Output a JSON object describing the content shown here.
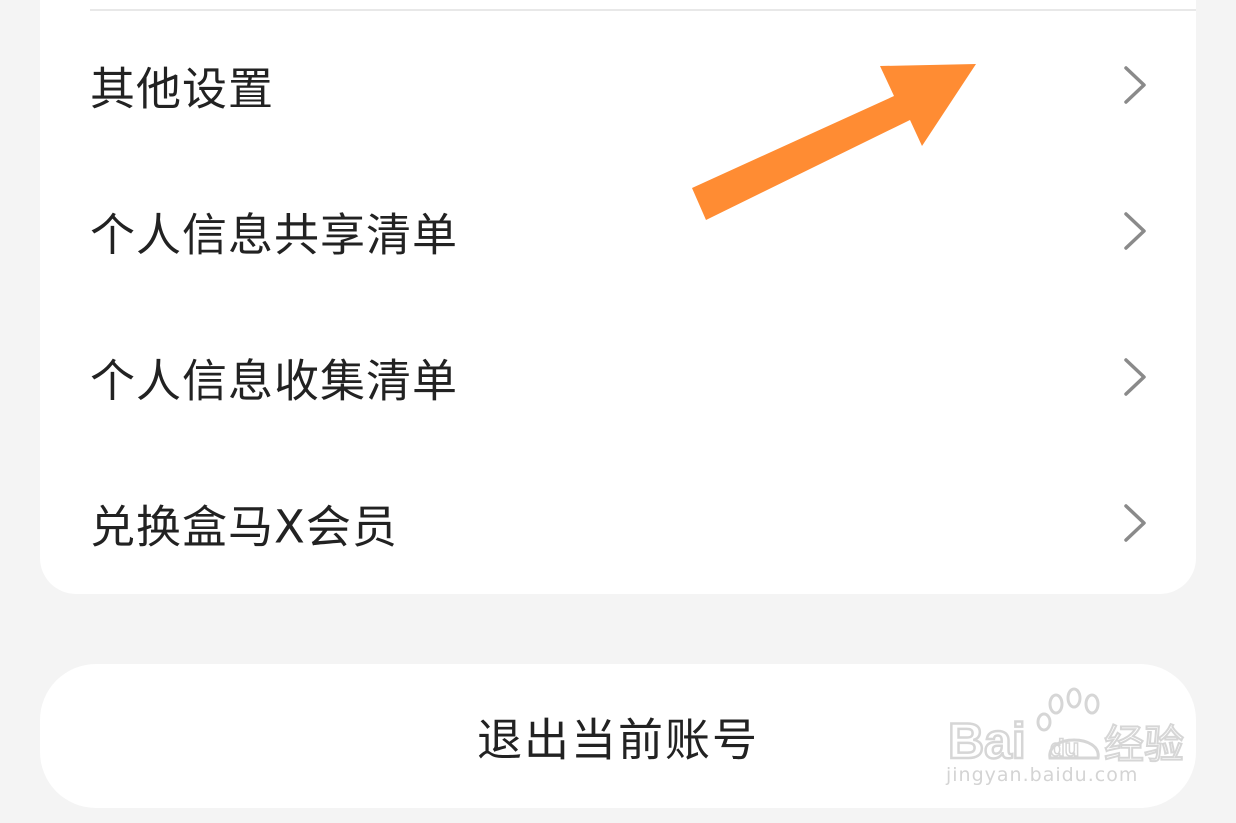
{
  "menu": {
    "items": [
      {
        "label": "其他设置",
        "icon": "chevron-right-icon"
      },
      {
        "label": "个人信息共享清单",
        "icon": "chevron-right-icon"
      },
      {
        "label": "个人信息收集清单",
        "icon": "chevron-right-icon"
      },
      {
        "label": "兑换盒马X会员",
        "icon": "chevron-right-icon"
      }
    ]
  },
  "logout": {
    "label": "退出当前账号"
  },
  "annotation": {
    "icon": "arrow-pointer-icon",
    "color": "#ff8c33"
  },
  "watermark": {
    "logo": "Baidu 经验",
    "site": "jingyan.baidu.com"
  },
  "colors": {
    "background": "#f4f4f4",
    "card": "#ffffff",
    "text": "#222222",
    "chevron": "#8a8a8a",
    "divider": "#e8e8e8"
  }
}
